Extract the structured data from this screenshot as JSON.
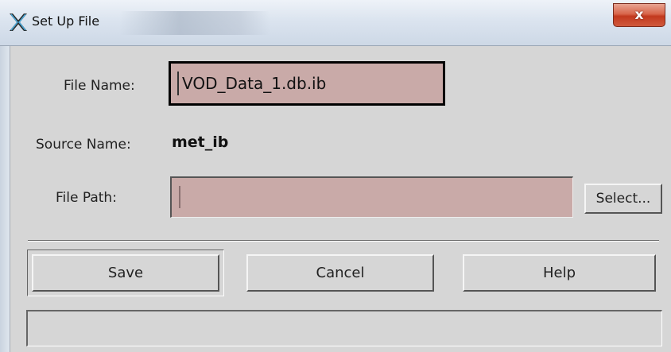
{
  "window": {
    "title": "Set Up File",
    "close_glyph": "x",
    "app_icon": "x-window-icon"
  },
  "form": {
    "file_name_label": "File Name:",
    "file_name_value": "VOD_Data_1.db.ib",
    "source_name_label": "Source Name:",
    "source_name_value": "met_ib",
    "file_path_label": "File Path:",
    "file_path_value": "",
    "select_button": "Select..."
  },
  "buttons": {
    "save": "Save",
    "cancel": "Cancel",
    "help": "Help"
  },
  "status": {
    "message": ""
  },
  "colors": {
    "field_background": "#c9aaa8",
    "dialog_background": "#d6d6d6",
    "close_button": "#c9452a"
  }
}
